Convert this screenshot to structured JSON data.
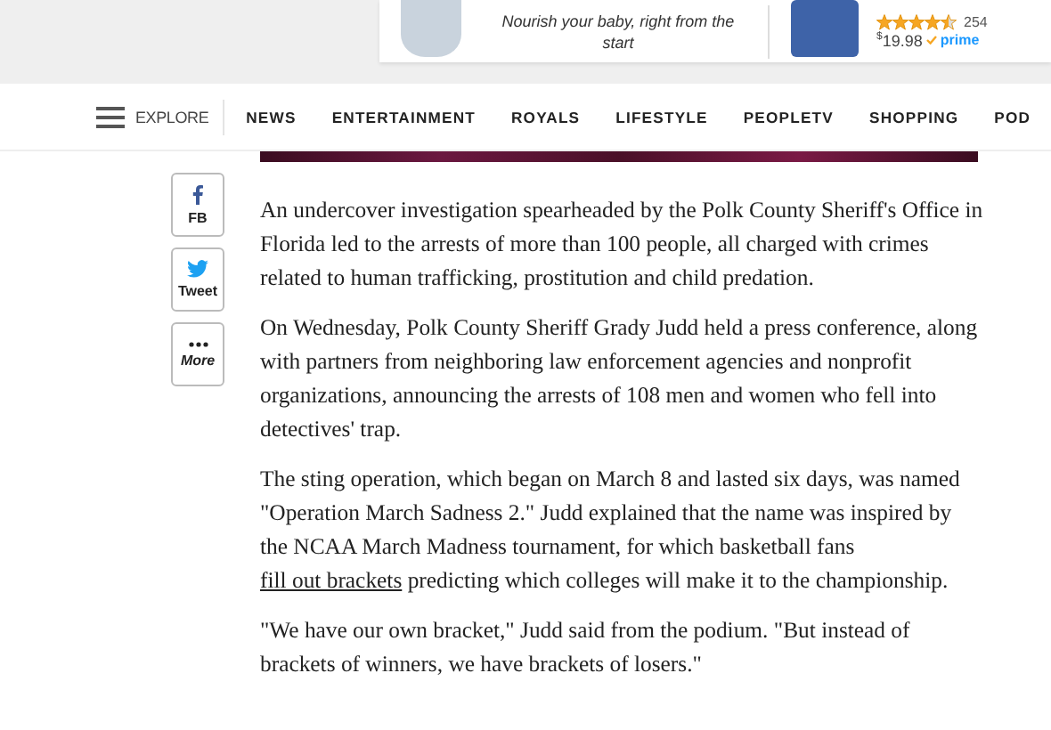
{
  "ad": {
    "tagline": "Nourish your baby, right from the start",
    "stars": 4.5,
    "review_count": "254",
    "price_currency": "$",
    "price": "19.98",
    "prime": "prime"
  },
  "nav": {
    "explore": "EXPLORE",
    "items": [
      {
        "label": "NEWS"
      },
      {
        "label": "ENTERTAINMENT"
      },
      {
        "label": "ROYALS"
      },
      {
        "label": "LIFESTYLE"
      },
      {
        "label": "PEOPLETV"
      },
      {
        "label": "SHOPPING"
      },
      {
        "label": "POD"
      }
    ]
  },
  "share": [
    {
      "kind": "facebook",
      "label": "FB"
    },
    {
      "kind": "twitter",
      "label": "Tweet"
    },
    {
      "kind": "more",
      "label": "More"
    }
  ],
  "paragraphs": [
    {
      "segments": [
        {
          "kind": "text",
          "text": "An undercover investigation spearheaded by the Polk County Sheriff's Office in Florida led to the arrests of more than 100 people, all charged with crimes related to human trafficking, prostitution and child predation."
        }
      ]
    },
    {
      "segments": [
        {
          "kind": "text",
          "text": "On Wednesday, Polk County Sheriff Grady Judd held a press conference, along with partners from neighboring law enforcement agencies and nonprofit organizations, announcing the arrests of 108 men and women who fell into detectives' trap."
        }
      ]
    },
    {
      "segments": [
        {
          "kind": "text",
          "text": "The sting operation, which began on March 8 and lasted six days, was named \"Operation March Sadness 2.\" Judd explained that the name was inspired by the NCAA March Madness tournament, for which basketball fans "
        },
        {
          "kind": "link",
          "text": "fill out brackets"
        },
        {
          "kind": "text",
          "text": " predicting which colleges will make it to the championship."
        }
      ]
    },
    {
      "segments": [
        {
          "kind": "text",
          "text": "\"We have our own bracket,\" Judd said from the podium. \"But instead of brackets of winners, we have brackets of losers.\""
        }
      ]
    }
  ]
}
